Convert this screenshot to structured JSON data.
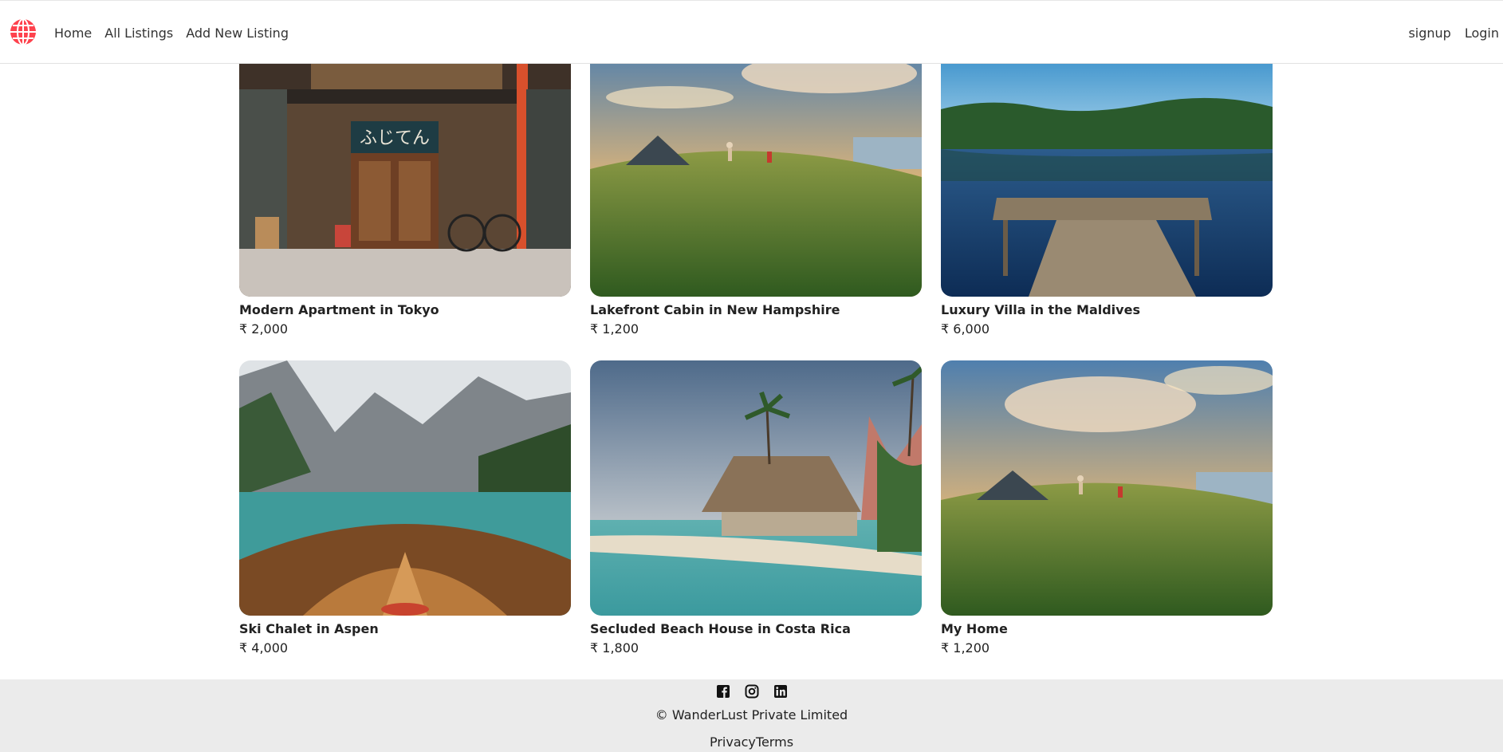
{
  "nav": {
    "links": [
      "Home",
      "All Listings",
      "Add New Listing"
    ],
    "right_links": [
      "signup",
      "Login"
    ],
    "brand_color": "#fe424d"
  },
  "listings": [
    {
      "title": "Modern Apartment in Tokyo",
      "price": "₹ 2,000"
    },
    {
      "title": "Lakefront Cabin in New Hampshire",
      "price": "₹ 1,200"
    },
    {
      "title": "Luxury Villa in the Maldives",
      "price": "₹ 6,000"
    },
    {
      "title": "Ski Chalet in Aspen",
      "price": "₹ 4,000"
    },
    {
      "title": "Secluded Beach House in Costa Rica",
      "price": "₹ 1,800"
    },
    {
      "title": "My Home",
      "price": "₹ 1,200"
    }
  ],
  "footer": {
    "social_icons": [
      "facebook-icon",
      "instagram-icon",
      "linkedin-icon"
    ],
    "copyright": "© WanderLust Private Limited",
    "privacy": "Privacy",
    "terms": "Terms",
    "background": "#ebebeb"
  }
}
